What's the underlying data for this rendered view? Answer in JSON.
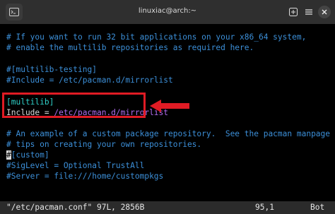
{
  "window": {
    "title": "linuxiac@arch:~",
    "icons": [
      "terminal-icon",
      "new-tab-icon",
      "menu-icon",
      "close-icon"
    ]
  },
  "editor": {
    "lines": [
      {
        "text": "# If you want to run 32 bit applications on your x86_64 system,",
        "kind": "comment"
      },
      {
        "text": "# enable the multilib repositories as required here.",
        "kind": "comment"
      },
      {
        "text": "",
        "kind": "blank"
      },
      {
        "text": "#[multilib-testing]",
        "kind": "comment"
      },
      {
        "text": "#Include = /etc/pacman.d/mirrorlist",
        "kind": "comment"
      },
      {
        "text": "",
        "kind": "blank"
      },
      {
        "section": "[multilib]",
        "kind": "section"
      },
      {
        "key": "Include = ",
        "path": "/etc/pacman.d/mirrorlist",
        "kind": "include"
      },
      {
        "text": "",
        "kind": "blank"
      },
      {
        "text": "# An example of a custom package repository.  See the pacman manpage for",
        "kind": "comment"
      },
      {
        "text": "# tips on creating your own repositories.",
        "kind": "comment"
      },
      {
        "cursor": "#",
        "text": "[custom]",
        "kind": "cursor-comment"
      },
      {
        "text": "#SigLevel = Optional TrustAll",
        "kind": "comment"
      },
      {
        "text": "#Server = file:///home/custompkgs",
        "kind": "comment"
      }
    ],
    "status": {
      "file": "\"/etc/pacman.conf\" 97L, 2856B",
      "position": "95,1",
      "scroll": "Bot"
    }
  },
  "annotation": {
    "highlight_color": "#e01b24"
  }
}
